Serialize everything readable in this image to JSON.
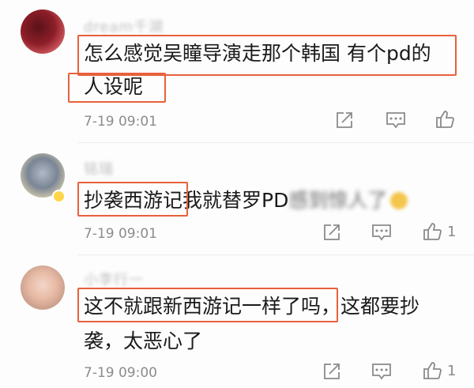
{
  "comments": [
    {
      "username": "dream千湖",
      "text_line1": "怎么感觉吴瞳导演走那个韩国 有个pd的",
      "text_line2": "人设呢",
      "timestamp": "7-19 09:01",
      "like_count": ""
    },
    {
      "username": "铭瑞",
      "text_highlight": "抄袭西游记",
      "text_rest": "我就替罗PD",
      "text_blurred": "感到惊人了",
      "timestamp": "7-19 09:01",
      "like_count": "1"
    },
    {
      "username": "小李行一",
      "text_line1": "这不就跟新西游记一样了吗，这都要抄",
      "text_line2": "袭，太恶心了",
      "timestamp": "7-19 09:00",
      "like_count": "1"
    }
  ],
  "colors": {
    "highlight": "#e8603c",
    "timestamp": "#8c8c8c",
    "text": "#1a1a1a"
  },
  "icons": [
    "share-icon",
    "comment-icon",
    "like-icon"
  ]
}
